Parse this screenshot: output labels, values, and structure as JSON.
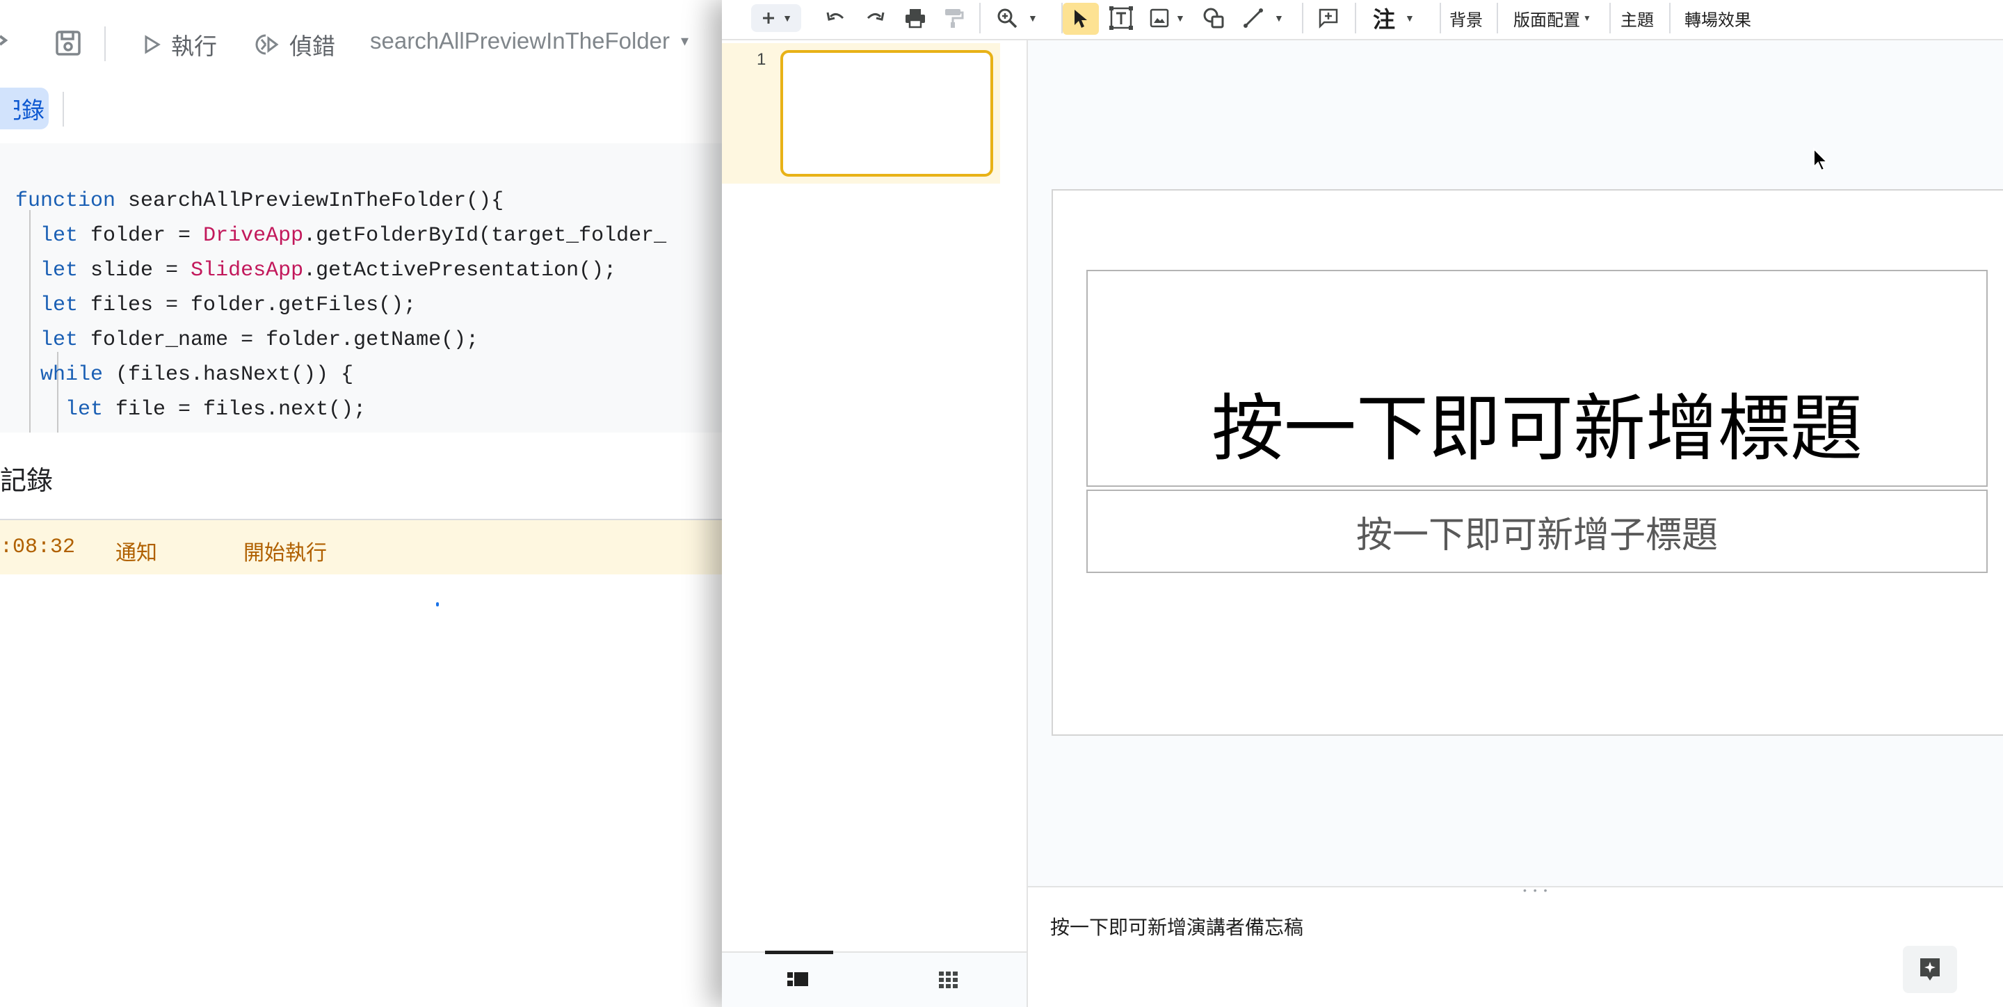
{
  "editor": {
    "toolbar": {
      "run_label": "執行",
      "debug_label": "偵錯",
      "function_selected": "searchAllPreviewInTheFolder"
    },
    "execution_log_chip": "記錄",
    "code_lines": [
      "function searchAllPreviewInTheFolder(){",
      "  let folder = DriveApp.getFolderById(target_folder_",
      "  let slide = SlidesApp.getActivePresentation();",
      "  let files = folder.getFiles();",
      "  let folder_name = folder.getName();",
      "  while (files.hasNext()) {",
      "    let file = files.next();"
    ],
    "log_panel": {
      "title": "記錄",
      "entries": [
        {
          "time": ":08:32",
          "level": "通知",
          "message": "開始執行"
        }
      ]
    }
  },
  "slides": {
    "toolbar": {
      "comment_label": "注",
      "background_label": "背景",
      "layout_label": "版面配置",
      "theme_label": "主題",
      "transition_label": "轉場效果"
    },
    "filmstrip": {
      "slides": [
        {
          "number": "1"
        }
      ]
    },
    "current_slide": {
      "title_placeholder": "按一下即可新增標題",
      "subtitle_placeholder": "按一下即可新增子標題"
    },
    "speaker_notes_placeholder": "按一下即可新增演講者備忘稿"
  },
  "colors": {
    "accent_blue": "#0b57d0",
    "selected_thumb_border": "#e8b217",
    "log_row_bg": "#fef7e0",
    "log_row_text": "#b06000"
  }
}
